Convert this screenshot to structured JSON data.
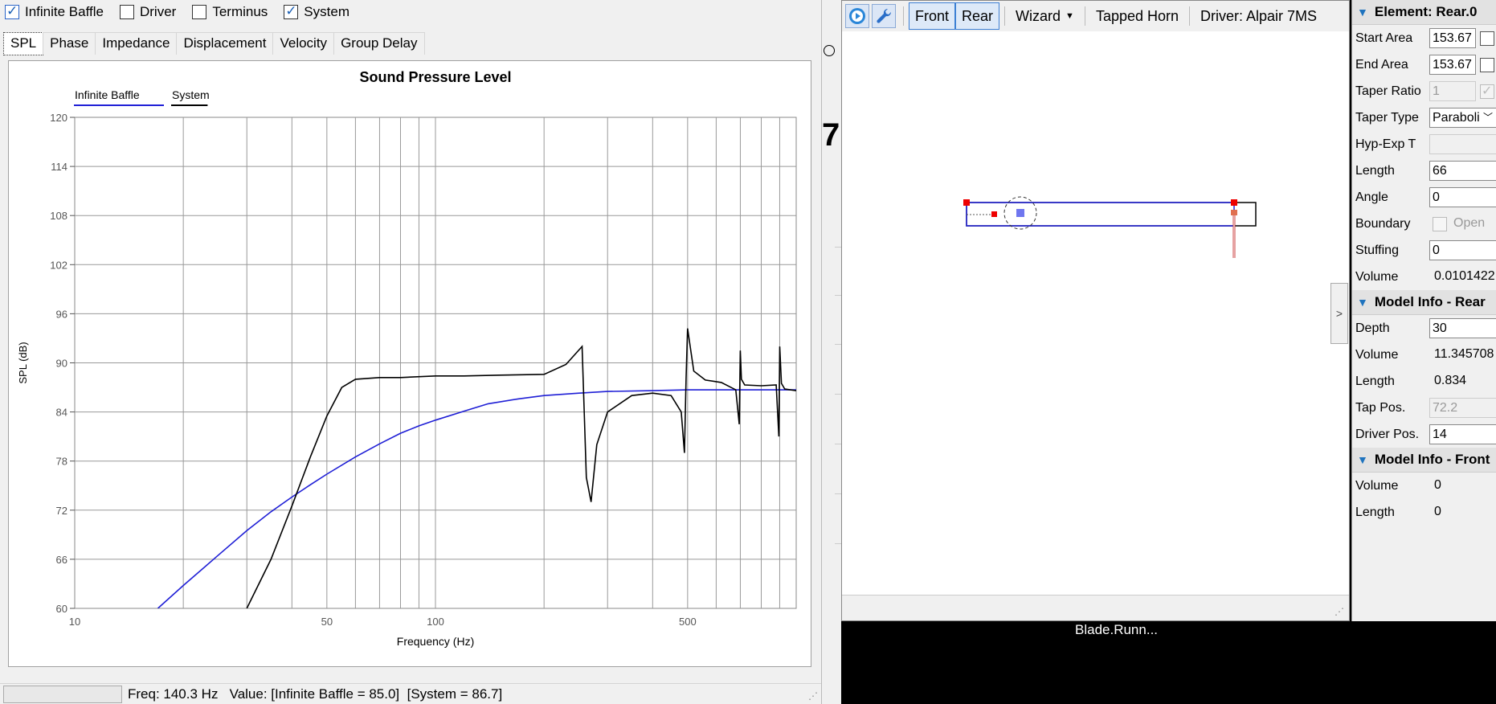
{
  "left_window": {
    "checkboxes": [
      {
        "label": "Infinite Baffle",
        "checked": true
      },
      {
        "label": "Driver",
        "checked": false
      },
      {
        "label": "Terminus",
        "checked": false
      },
      {
        "label": "System",
        "checked": true
      }
    ],
    "tabs": [
      "SPL",
      "Phase",
      "Impedance",
      "Displacement",
      "Velocity",
      "Group Delay"
    ],
    "active_tab": "SPL",
    "status": {
      "text": "Freq: 140.3 Hz   Value: [Infinite Baffle = 85.0]  [System = 86.7]"
    }
  },
  "chart_data": {
    "type": "line",
    "title": "Sound Pressure Level",
    "xlabel": "Frequency (Hz)",
    "ylabel": "SPL (dB)",
    "x_scale": "log",
    "xlim": [
      10,
      1000
    ],
    "ylim": [
      60,
      120
    ],
    "x_tick_labels": [
      "10",
      "50",
      "100",
      "500"
    ],
    "y_ticks": [
      60,
      66,
      72,
      78,
      84,
      90,
      96,
      102,
      108,
      114,
      120
    ],
    "grid": true,
    "legend_position": "top-left",
    "series": [
      {
        "name": "Infinite Baffle",
        "color": "#1f1fd6",
        "x": [
          17,
          20,
          25,
          30,
          35,
          40,
          45,
          50,
          60,
          70,
          80,
          90,
          100,
          120,
          140,
          170,
          200,
          250,
          300,
          400,
          500,
          700,
          1000
        ],
        "y": [
          60,
          62.8,
          66.5,
          69.5,
          71.8,
          73.6,
          75.1,
          76.4,
          78.5,
          80.1,
          81.4,
          82.3,
          83.0,
          84.1,
          85.0,
          85.6,
          86.0,
          86.3,
          86.5,
          86.6,
          86.7,
          86.7,
          86.7
        ]
      },
      {
        "name": "System",
        "color": "#000000",
        "x": [
          30,
          35,
          40,
          45,
          50,
          55,
          60,
          70,
          80,
          100,
          120,
          150,
          200,
          230,
          255,
          262,
          270,
          280,
          300,
          350,
          400,
          450,
          480,
          490,
          495,
          500,
          520,
          560,
          620,
          680,
          695,
          700,
          705,
          720,
          800,
          880,
          895,
          900,
          910,
          930,
          1000
        ],
        "y": [
          60,
          66,
          72.5,
          78.5,
          83.5,
          87.0,
          88.0,
          88.2,
          88.2,
          88.4,
          88.4,
          88.5,
          88.6,
          89.8,
          92.0,
          76,
          73,
          80,
          84,
          86.0,
          86.3,
          86.0,
          84,
          79,
          88,
          94.2,
          89,
          87.9,
          87.6,
          86.7,
          82.5,
          91.5,
          88,
          87.3,
          87.2,
          87.3,
          81,
          92,
          87.5,
          86.8,
          86.6
        ]
      }
    ]
  },
  "middle_window": {
    "toolbar": {
      "front": "Front",
      "rear": "Rear",
      "wizard": "Wizard",
      "tapped_horn": "Tapped Horn",
      "driver": "Driver: Alpair 7MS"
    }
  },
  "taskbar_label": "Blade.Runn...",
  "properties": {
    "element_header": "Element: Rear.0",
    "element_rows": [
      {
        "label": "Start Area",
        "value": "153.67"
      },
      {
        "label": "End Area",
        "value": "153.67"
      },
      {
        "label": "Taper Ratio",
        "value": "1"
      },
      {
        "label": "Taper Type",
        "value": "Paraboli"
      },
      {
        "label": "Hyp-Exp T",
        "value": ""
      },
      {
        "label": "Length",
        "value": "66"
      },
      {
        "label": "Angle",
        "value": "0"
      },
      {
        "label": "Boundary",
        "value": "Open"
      },
      {
        "label": "Stuffing",
        "value": "0"
      },
      {
        "label": "Volume",
        "value": "0.0101422"
      }
    ],
    "model_rear_header": "Model Info - Rear",
    "model_rear_rows": [
      {
        "label": "Depth",
        "value": "30"
      },
      {
        "label": "Volume",
        "value": "11.345708"
      },
      {
        "label": "Length",
        "value": "0.834"
      },
      {
        "label": "Tap Pos.",
        "value": "72.2"
      },
      {
        "label": "Driver Pos.",
        "value": "14"
      }
    ],
    "model_front_header": "Model Info - Front",
    "model_front_rows": [
      {
        "label": "Volume",
        "value": "0"
      },
      {
        "label": "Length",
        "value": "0"
      }
    ]
  }
}
